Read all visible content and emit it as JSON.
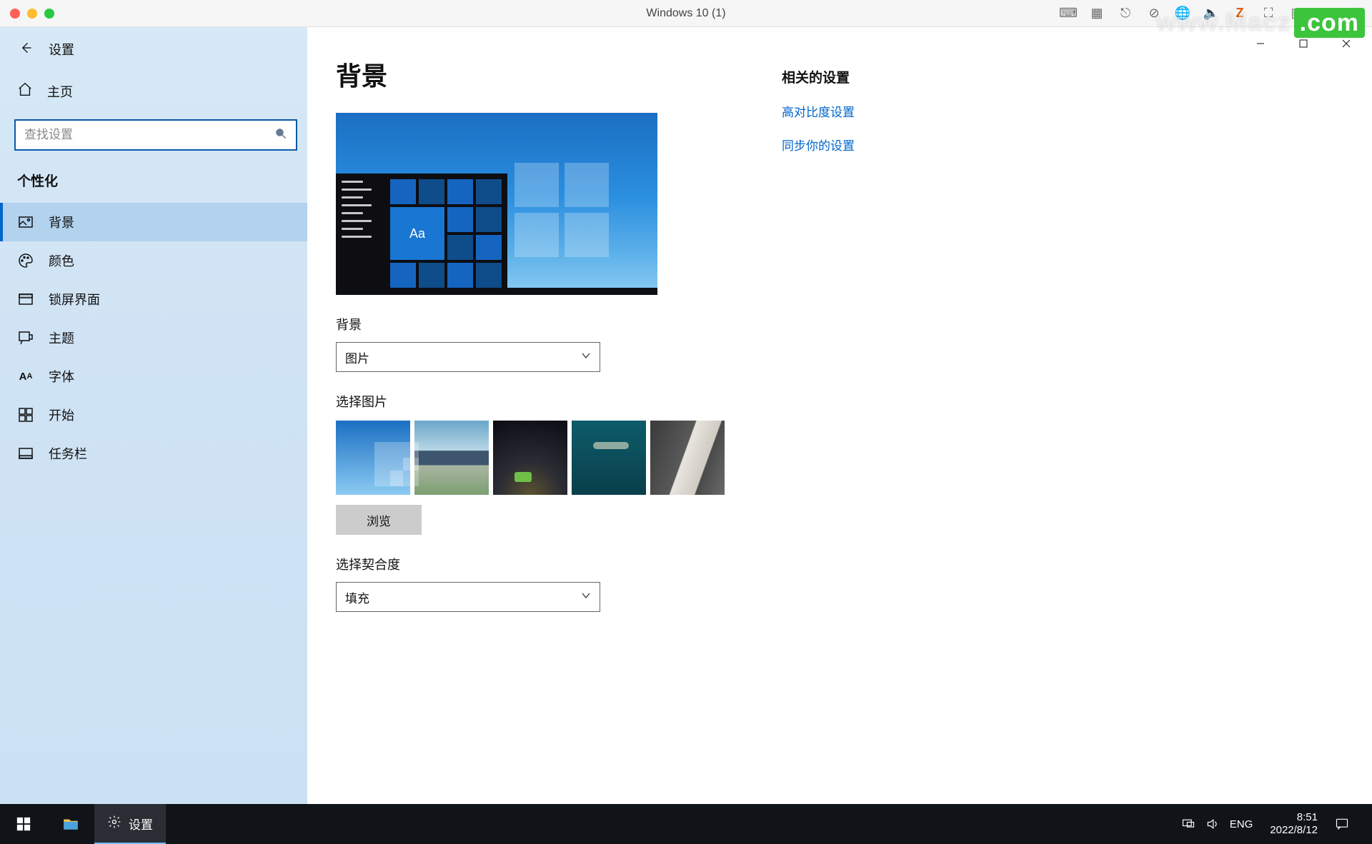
{
  "vm": {
    "title": "Windows 10 (1)",
    "right_icons": [
      "keyboard-icon",
      "chip-icon",
      "usb-icon",
      "disc-icon",
      "globe-icon",
      "speaker-icon",
      "z-icon",
      "fullscreen-icon",
      "dual-screen-icon",
      "pip-icon",
      "gear-icon"
    ]
  },
  "watermark": {
    "text": "www.Macz",
    "suffix": ".com"
  },
  "window_controls": {
    "minimize": "—",
    "maximize": "▢",
    "close": "✕"
  },
  "settings_header": {
    "title": "设置"
  },
  "home": {
    "label": "主页"
  },
  "search": {
    "placeholder": "查找设置"
  },
  "category": {
    "label": "个性化"
  },
  "nav": {
    "items": [
      {
        "id": "background",
        "label": "背景",
        "icon": "picture-icon",
        "active": true
      },
      {
        "id": "colors",
        "label": "颜色",
        "icon": "palette-icon",
        "active": false
      },
      {
        "id": "lockscreen",
        "label": "锁屏界面",
        "icon": "lockscreen-icon",
        "active": false
      },
      {
        "id": "themes",
        "label": "主题",
        "icon": "brush-icon",
        "active": false
      },
      {
        "id": "fonts",
        "label": "字体",
        "icon": "font-icon",
        "active": false
      },
      {
        "id": "start",
        "label": "开始",
        "icon": "start-grid-icon",
        "active": false
      },
      {
        "id": "taskbar",
        "label": "任务栏",
        "icon": "taskbar-icon",
        "active": false
      }
    ]
  },
  "main": {
    "page_title": "背景",
    "preview_tile_text": "Aa",
    "bg_label": "背景",
    "bg_dropdown_value": "图片",
    "choose_picture_label": "选择图片",
    "browse_button": "浏览",
    "fit_label": "选择契合度",
    "fit_dropdown_value": "填充"
  },
  "related": {
    "title": "相关的设置",
    "links": [
      {
        "id": "high-contrast",
        "label": "高对比度设置"
      },
      {
        "id": "sync",
        "label": "同步你的设置"
      }
    ]
  },
  "taskbar": {
    "settings_app_label": "设置",
    "ime": "ENG",
    "time": "8:51",
    "date": "2022/8/12"
  }
}
